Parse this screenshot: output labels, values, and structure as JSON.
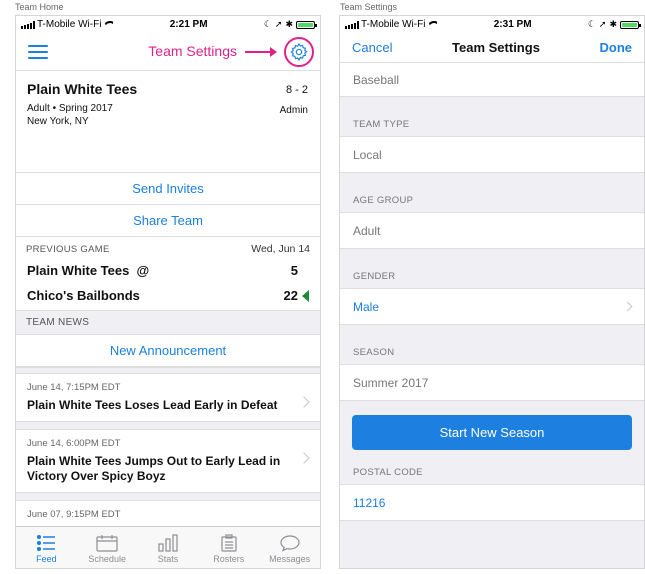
{
  "captions": {
    "left": "Team Home",
    "right": "Team Settings"
  },
  "status_left": {
    "carrier": "T-Mobile Wi-Fi",
    "time": "2:21 PM"
  },
  "status_right": {
    "carrier": "T-Mobile Wi-Fi",
    "time": "2:31 PM"
  },
  "home": {
    "annotation": "Team Settings",
    "team": {
      "name": "Plain White Tees",
      "record": "8 - 2",
      "meta": "Adult • Spring 2017",
      "location": "New York, NY",
      "role": "Admin"
    },
    "send_invites": "Send Invites",
    "share_team": "Share Team",
    "previous_game": {
      "label": "PREVIOUS GAME",
      "date": "Wed, Jun 14",
      "home": "Plain White Tees  @",
      "home_score": "5",
      "away": "Chico's Bailbonds",
      "away_score": "22"
    },
    "news_label": "TEAM NEWS",
    "new_announcement": "New Announcement",
    "news": [
      {
        "date": "June 14, 7:15PM EDT",
        "title": "Plain White Tees Loses Lead Early in Defeat"
      },
      {
        "date": "June 14, 6:00PM EDT",
        "title": "Plain White Tees Jumps Out to Early Lead in Victory Over Spicy Boyz"
      },
      {
        "date": "June 07, 9:15PM EDT"
      }
    ],
    "tabs": [
      "Feed",
      "Schedule",
      "Stats",
      "Rosters",
      "Messages"
    ]
  },
  "settings": {
    "cancel": "Cancel",
    "title": "Team Settings",
    "done": "Done",
    "sport": "Baseball",
    "team_type_label": "TEAM TYPE",
    "team_type": "Local",
    "age_group_label": "AGE GROUP",
    "age_group": "Adult",
    "gender_label": "GENDER",
    "gender": "Male",
    "season_label": "SEASON",
    "season": "Summer 2017",
    "start_new_season": "Start New Season",
    "postal_label": "POSTAL CODE",
    "postal": "11216"
  },
  "colors": {
    "accent": "#1d7fe0",
    "annotation": "#e0218a",
    "win": "#1a8c35"
  }
}
